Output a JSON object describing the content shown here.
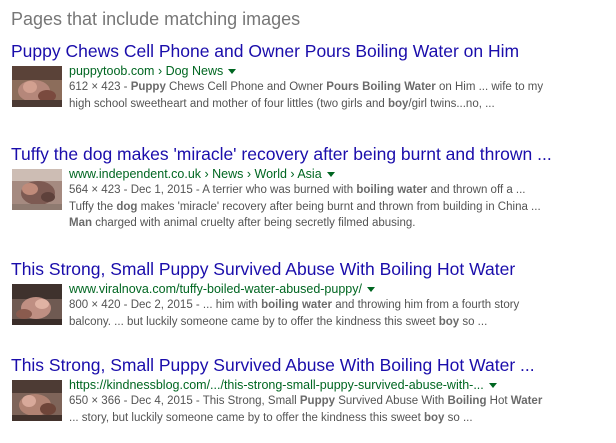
{
  "section_title": "Pages that include matching images",
  "results": [
    {
      "title": "Puppy Chews Cell Phone and Owner Pours Boiling Water on Him",
      "url": "puppytoob.com › Dog News",
      "snippet_lines": [
        [
          {
            "t": "612 × 423 - ",
            "b": false
          },
          {
            "t": "Puppy",
            "b": true
          },
          {
            "t": " Chews Cell Phone and Owner ",
            "b": false
          },
          {
            "t": "Pours Boiling Water",
            "b": true
          },
          {
            "t": " on Him ... wife to my",
            "b": false
          }
        ],
        [
          {
            "t": "high school sweetheart and mother of four littles (two girls and ",
            "b": false
          },
          {
            "t": "boy",
            "b": true
          },
          {
            "t": "/girl twins...no, ...",
            "b": false
          }
        ]
      ]
    },
    {
      "title": "Tuffy the dog makes 'miracle' recovery after being burnt and thrown ...",
      "url": "www.independent.co.uk › News › World › Asia",
      "snippet_lines": [
        [
          {
            "t": "564 × 423 - Dec 1, 2015 - A terrier who was burned with ",
            "b": false
          },
          {
            "t": "boiling water",
            "b": true
          },
          {
            "t": " and thrown off a ...",
            "b": false
          }
        ],
        [
          {
            "t": "Tuffy the ",
            "b": false
          },
          {
            "t": "dog",
            "b": true
          },
          {
            "t": " makes 'miracle' recovery after being burnt and thrown from building in China ...",
            "b": false
          }
        ],
        [
          {
            "t": "Man",
            "b": true
          },
          {
            "t": " charged with animal cruelty after being secretly filmed abusing.",
            "b": false
          }
        ]
      ]
    },
    {
      "title": "This Strong, Small Puppy Survived Abuse With Boiling Hot Water",
      "url": "www.viralnova.com/tuffy-boiled-water-abused-puppy/",
      "snippet_lines": [
        [
          {
            "t": "800 × 420 - Dec 2, 2015 - ... him with ",
            "b": false
          },
          {
            "t": "boiling water",
            "b": true
          },
          {
            "t": " and throwing him from a fourth story",
            "b": false
          }
        ],
        [
          {
            "t": "balcony. ... but luckily someone came by to offer the kindness this sweet ",
            "b": false
          },
          {
            "t": "boy",
            "b": true
          },
          {
            "t": " so ...",
            "b": false
          }
        ]
      ]
    },
    {
      "title": "This Strong, Small Puppy Survived Abuse With Boiling Hot Water ...",
      "url": "https://kindnessblog.com/.../this-strong-small-puppy-survived-abuse-with-...",
      "snippet_lines": [
        [
          {
            "t": "650 × 366 - Dec 4, 2015 - This Strong, Small ",
            "b": false
          },
          {
            "t": "Puppy",
            "b": true
          },
          {
            "t": " Survived Abuse With ",
            "b": false
          },
          {
            "t": "Boiling",
            "b": true
          },
          {
            "t": " Hot ",
            "b": false
          },
          {
            "t": "Water",
            "b": true
          }
        ],
        [
          {
            "t": "... story, but luckily someone came by to offer the kindness this sweet ",
            "b": false
          },
          {
            "t": "boy",
            "b": true
          },
          {
            "t": " so ...",
            "b": false
          }
        ]
      ]
    }
  ],
  "colors": {
    "title_link": "#1a0dab",
    "url_green": "#006621",
    "snippet_gray": "#545454",
    "section_gray": "#777777"
  },
  "icons": {
    "dropdown": "caret-down-icon"
  }
}
